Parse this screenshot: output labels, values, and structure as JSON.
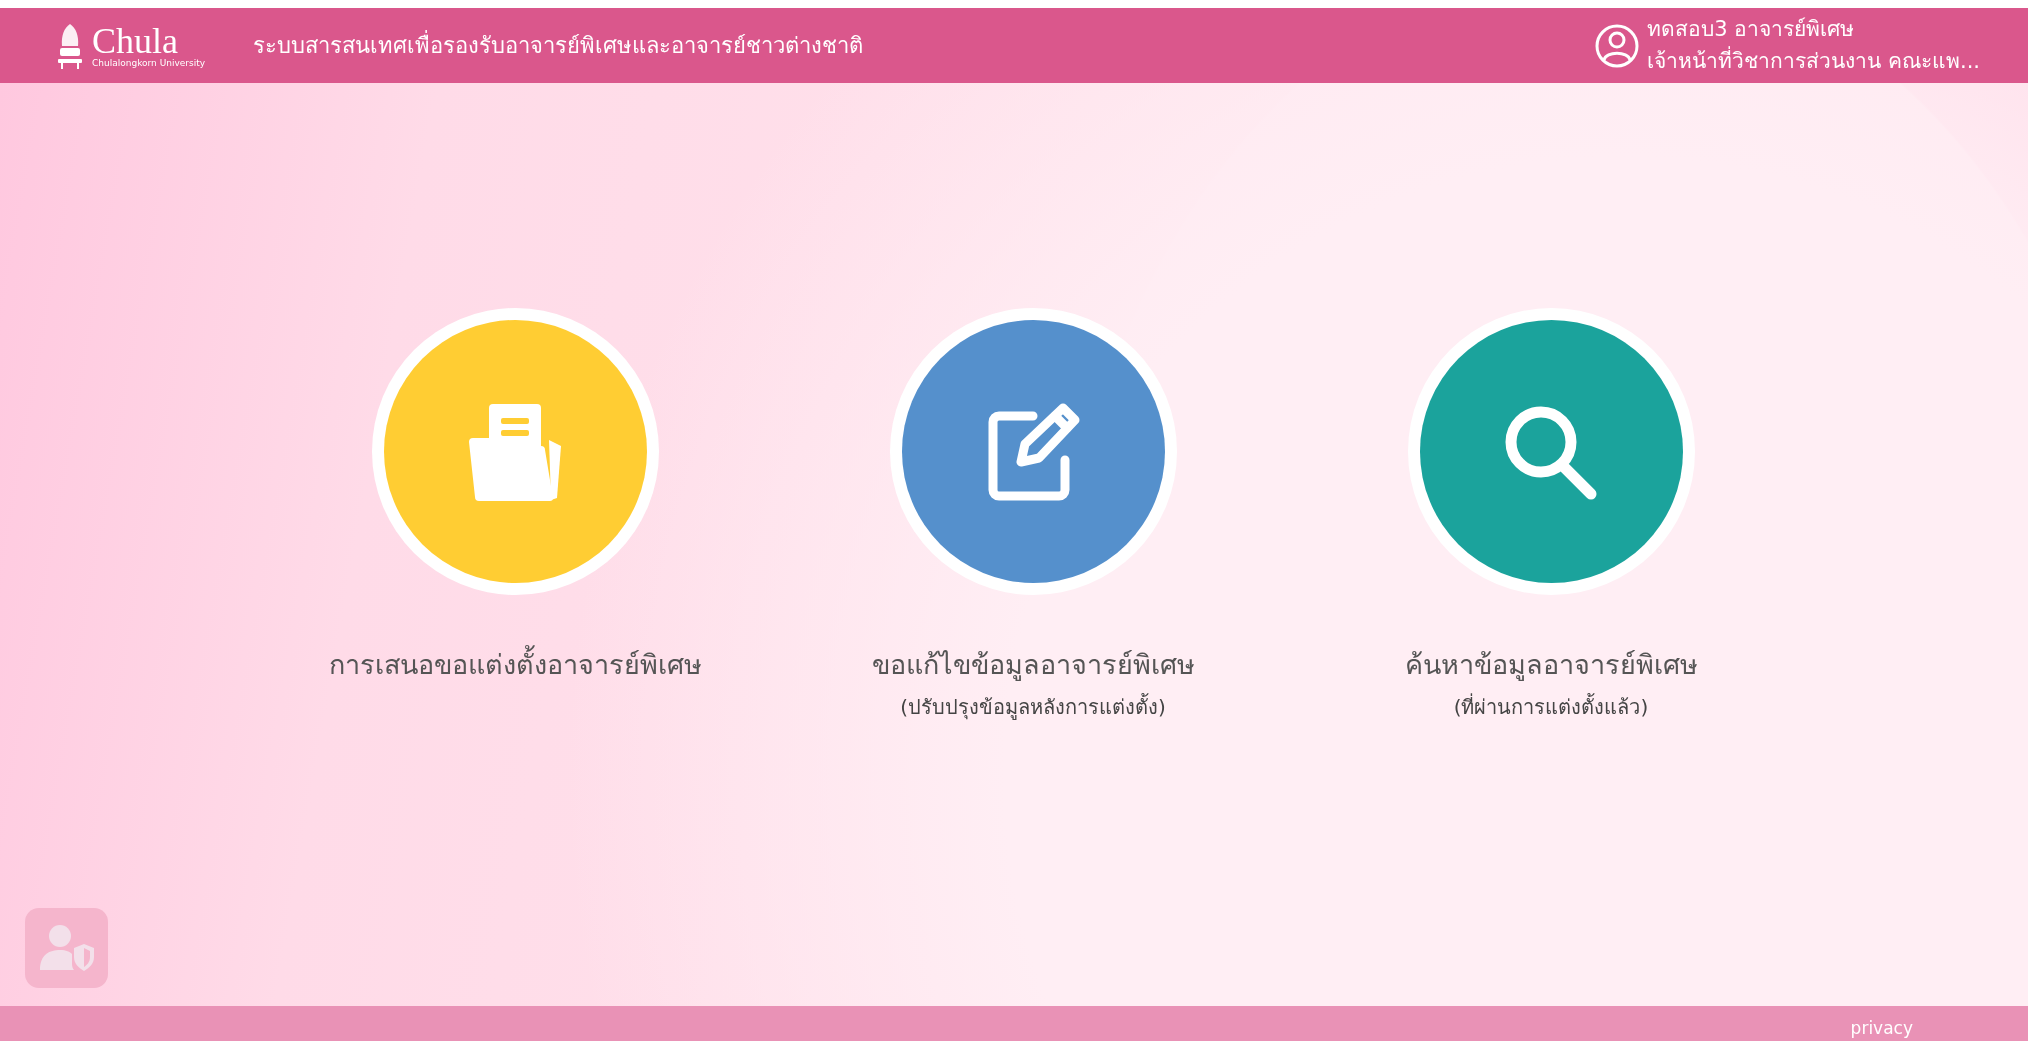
{
  "header": {
    "logo": {
      "wordmark": "Chula",
      "subtitle": "Chulalongkorn University"
    },
    "title": "ระบบสารสนเทศเพื่อรองรับอาจารย์พิเศษและอาจารย์ชาวต่างชาติ",
    "user": {
      "name": "ทดสอบ3 อาจารย์พิเศษ",
      "role": "เจ้าหน้าที่วิชาการส่วนงาน คณะแพ..."
    }
  },
  "menu": [
    {
      "kind": "folder",
      "color": "#ffcd33",
      "title": "การเสนอขอแต่งตั้งอาจารย์พิเศษ"
    },
    {
      "kind": "edit",
      "color": "#5590cc",
      "title": "ขอแก้ไขข้อมูลอาจารย์พิเศษ",
      "subtitle": "(ปรับปรุงข้อมูลหลังการแต่งตั้ง)"
    },
    {
      "kind": "search",
      "color": "#1ba39c",
      "title": "ค้นหาข้อมูลอาจารย์พิเศษ",
      "subtitle": "(ที่ผ่านการแต่งตั้งแล้ว)"
    }
  ],
  "footer": {
    "link": "privacy"
  }
}
